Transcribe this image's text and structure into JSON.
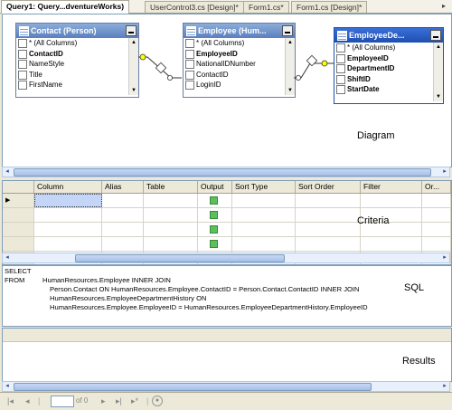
{
  "tabs": [
    {
      "label": "Query1: Query...dventureWorks)",
      "active": true
    },
    {
      "label": "UserControl3.cs [Design]*",
      "active": false
    },
    {
      "label": "Form1.cs*",
      "active": false
    },
    {
      "label": "Form1.cs [Design]*",
      "active": false
    }
  ],
  "diagram": {
    "label": "Diagram",
    "tables": [
      {
        "title": "Contact (Person)",
        "columns": [
          "* (All Columns)",
          "ContactID",
          "NameStyle",
          "Title",
          "FirstName"
        ]
      },
      {
        "title": "Employee (Hum...",
        "columns": [
          "* (All Columns)",
          "EmployeeID",
          "NationalIDNumber",
          "ContactID",
          "LoginID"
        ]
      },
      {
        "title": "EmployeeDe...",
        "columns": [
          "* (All Columns)",
          "EmployeeID",
          "DepartmentID",
          "ShiftID",
          "StartDate"
        ]
      }
    ]
  },
  "criteria": {
    "label": "Criteria",
    "headers": [
      "Column",
      "Alias",
      "Table",
      "Output",
      "Sort Type",
      "Sort Order",
      "Filter",
      "Or..."
    ],
    "row_count": 5
  },
  "sql": {
    "label": "SQL",
    "lines": [
      {
        "kw": "SELECT",
        "text": ""
      },
      {
        "kw": "FROM",
        "text": "HumanResources.Employee INNER JOIN"
      },
      {
        "kw": "",
        "text": "Person.Contact ON HumanResources.Employee.ContactID = Person.Contact.ContactID INNER JOIN"
      },
      {
        "kw": "",
        "text": "HumanResources.EmployeeDepartmentHistory ON"
      },
      {
        "kw": "",
        "text": "HumanResources.Employee.EmployeeID = HumanResources.EmployeeDepartmentHistory.EmployeeID"
      }
    ]
  },
  "results": {
    "label": "Results"
  },
  "navigator": {
    "page_value": "",
    "of_text": "of 0"
  },
  "icons": {
    "table": "table-icon",
    "minimize": "minimize-icon",
    "key": "join-key-icon"
  }
}
